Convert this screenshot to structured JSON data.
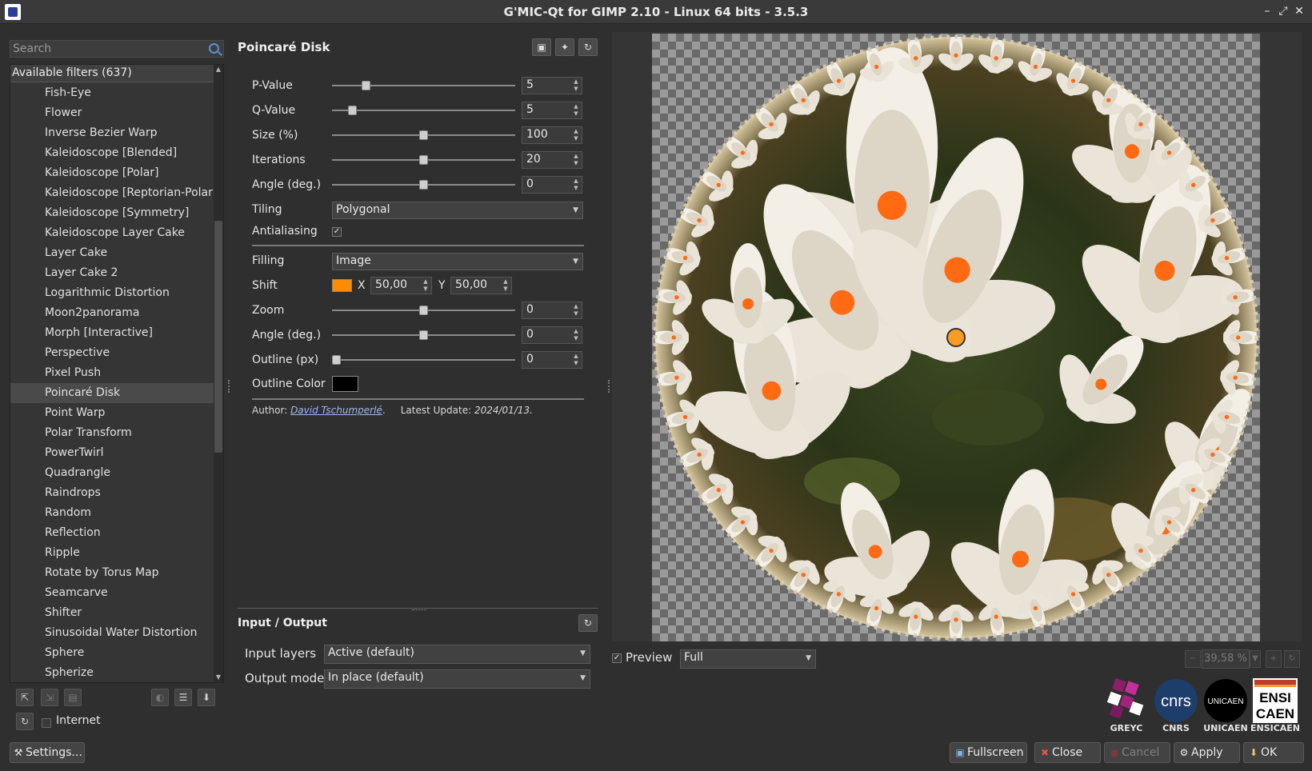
{
  "window": {
    "title": "G'MIC-Qt for GIMP 2.10 - Linux 64 bits - 3.5.3"
  },
  "search": {
    "placeholder": "Search"
  },
  "filters": {
    "header": "Available filters (637)",
    "items": [
      "Fish-Eye",
      "Flower",
      "Inverse Bezier Warp",
      "Kaleidoscope [Blended]",
      "Kaleidoscope [Polar]",
      "Kaleidoscope [Reptorian-Polar]",
      "Kaleidoscope [Symmetry]",
      "Kaleidoscope Layer Cake",
      "Layer Cake",
      "Layer Cake 2",
      "Logarithmic Distortion",
      "Moon2panorama",
      "Morph [Interactive]",
      "Perspective",
      "Pixel Push",
      "Poincaré Disk",
      "Point Warp",
      "Polar Transform",
      "PowerTwirl",
      "Quadrangle",
      "Raindrops",
      "Random",
      "Reflection",
      "Ripple",
      "Rotate by Torus Map",
      "Seamcarve",
      "Shifter",
      "Sinusoidal Water Distortion",
      "Sphere",
      "Spherize"
    ],
    "selected": "Poincaré Disk"
  },
  "bottom_left": {
    "internet_label": "Internet",
    "settings_label": "Settings..."
  },
  "filter": {
    "title": "Poincaré Disk",
    "params": {
      "p_value": {
        "label": "P-Value",
        "value": "5",
        "fraction": 0.17
      },
      "q_value": {
        "label": "Q-Value",
        "value": "5",
        "fraction": 0.09
      },
      "size": {
        "label": "Size (%)",
        "value": "100",
        "fraction": 0.5
      },
      "iterations": {
        "label": "Iterations",
        "value": "20",
        "fraction": 0.5
      },
      "angle1": {
        "label": "Angle (deg.)",
        "value": "0",
        "fraction": 0.5
      },
      "tiling": {
        "label": "Tiling",
        "value": "Polygonal"
      },
      "antialiasing": {
        "label": "Antialiasing",
        "checked": "✓"
      },
      "filling": {
        "label": "Filling",
        "value": "Image"
      },
      "shift": {
        "label": "Shift",
        "color": "#ff8c00",
        "x_label": "X",
        "x_value": "50,00",
        "y_label": "Y",
        "y_value": "50,00"
      },
      "zoom": {
        "label": "Zoom",
        "value": "0",
        "fraction": 0.5
      },
      "angle2": {
        "label": "Angle (deg.)",
        "value": "0",
        "fraction": 0.5
      },
      "outline": {
        "label": "Outline (px)",
        "value": "0",
        "fraction": 0.0
      },
      "outline_color": {
        "label": "Outline Color",
        "color": "#000000"
      }
    },
    "author_prefix": "Author:",
    "author_name": "David Tschumperlé",
    "update_prefix": "Latest Update:",
    "update_date": "2024/01/13."
  },
  "io": {
    "title": "Input / Output",
    "input_layers_label": "Input layers",
    "input_layers_value": "Active (default)",
    "output_mode_label": "Output mode",
    "output_mode_value": "In place (default)"
  },
  "preview": {
    "label": "Preview",
    "checked": "✓",
    "mode": "Full",
    "zoom": "39,58 %"
  },
  "logos": [
    "GREYC",
    "CNRS",
    "UNICAEN",
    "ENSICAEN"
  ],
  "logo_text": {
    "cnrs": "cnrs",
    "unicaen": "UNICAEN",
    "ensicaen_1": "ENSI",
    "ensicaen_2": "CAEN"
  },
  "actions": {
    "fullscreen": "Fullscreen",
    "close": "Close",
    "cancel": "Cancel",
    "apply": "Apply",
    "ok": "OK"
  }
}
